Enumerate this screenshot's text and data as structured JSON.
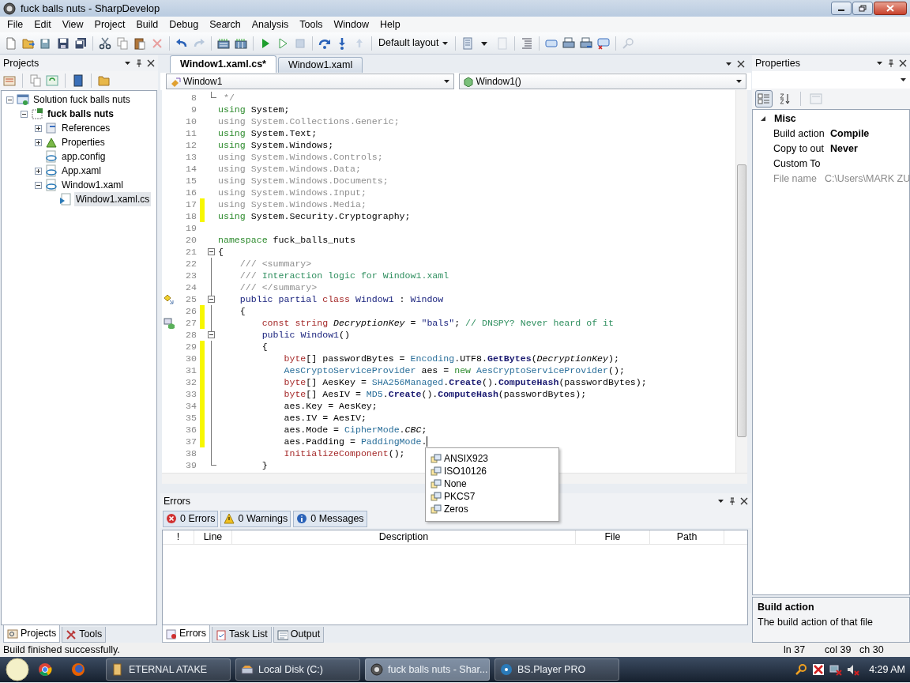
{
  "window": {
    "title": "fuck balls nuts - SharpDevelop"
  },
  "menu": [
    "File",
    "Edit",
    "View",
    "Project",
    "Build",
    "Debug",
    "Search",
    "Analysis",
    "Tools",
    "Window",
    "Help"
  ],
  "toolbar": {
    "layout": "Default layout"
  },
  "projects_panel": {
    "title": "Projects",
    "tree": [
      {
        "label": "Solution fuck balls nuts",
        "kind": "solution",
        "expanded": true,
        "selected": false,
        "children": [
          {
            "label": "fuck balls nuts",
            "kind": "project",
            "startup": true,
            "expanded": true,
            "selected": false,
            "children": [
              {
                "label": "References",
                "kind": "references",
                "expanded": false,
                "selected": false
              },
              {
                "label": "Properties",
                "kind": "properties",
                "expanded": false,
                "selected": false
              },
              {
                "label": "app.config",
                "kind": "xml",
                "selected": false
              },
              {
                "label": "App.xaml",
                "kind": "xml",
                "expanded": false,
                "selected": false
              },
              {
                "label": "Window1.xaml",
                "kind": "xml",
                "expanded": true,
                "selected": false,
                "children": [
                  {
                    "label": "Window1.xaml.cs",
                    "kind": "code",
                    "selected": true
                  }
                ]
              }
            ]
          }
        ]
      }
    ],
    "tabs": [
      {
        "label": "Projects",
        "selected": true
      },
      {
        "label": "Tools",
        "selected": false
      }
    ]
  },
  "editor": {
    "tabs": [
      {
        "label": "Window1.xaml.cs*",
        "selected": true
      },
      {
        "label": "Window1.xaml",
        "selected": false
      }
    ],
    "class_combo": "Window1",
    "member_combo": "Window1()",
    "lines": [
      {
        "n": "8",
        "changed": false,
        "fold_end": true,
        "seg": [
          {
            "text": " */",
            "kind": "dim"
          }
        ]
      },
      {
        "n": "9",
        "changed": false,
        "seg": [
          {
            "text": "using",
            "kind": "kw"
          },
          {
            "text": " System;",
            "kind": "plain"
          }
        ]
      },
      {
        "n": "10",
        "changed": false,
        "seg": [
          {
            "text": "using System.Collections.Generic;",
            "kind": "dim"
          }
        ]
      },
      {
        "n": "11",
        "changed": false,
        "seg": [
          {
            "text": "using",
            "kind": "kw"
          },
          {
            "text": " System.Text;",
            "kind": "plain"
          }
        ]
      },
      {
        "n": "12",
        "changed": false,
        "seg": [
          {
            "text": "using",
            "kind": "kw"
          },
          {
            "text": " System.Windows;",
            "kind": "plain"
          }
        ]
      },
      {
        "n": "13",
        "changed": false,
        "seg": [
          {
            "text": "using System.Windows.Controls;",
            "kind": "dim"
          }
        ]
      },
      {
        "n": "14",
        "changed": false,
        "seg": [
          {
            "text": "using System.Windows.Data;",
            "kind": "dim"
          }
        ]
      },
      {
        "n": "15",
        "changed": false,
        "seg": [
          {
            "text": "using System.Windows.Documents;",
            "kind": "dim"
          }
        ]
      },
      {
        "n": "16",
        "changed": false,
        "seg": [
          {
            "text": "using System.Windows.Input;",
            "kind": "dim"
          }
        ]
      },
      {
        "n": "17",
        "changed": true,
        "seg": [
          {
            "text": "using System.Windows.Media;",
            "kind": "dim"
          }
        ]
      },
      {
        "n": "18",
        "changed": true,
        "seg": [
          {
            "text": "using",
            "kind": "kw"
          },
          {
            "text": " System.Security.Cryptography;",
            "kind": "plain"
          }
        ]
      },
      {
        "n": "19",
        "changed": false
      },
      {
        "n": "20",
        "changed": false,
        "seg": [
          {
            "text": "namespace",
            "kind": "kw"
          },
          {
            "text": " fuck_balls_nuts",
            "kind": "plain"
          }
        ]
      },
      {
        "n": "21",
        "changed": false,
        "fold_open": true,
        "seg": [
          {
            "text": "{",
            "kind": "plain"
          }
        ]
      },
      {
        "n": "22",
        "changed": false,
        "seg": [
          {
            "text": "    /// <summary>",
            "kind": "dim"
          }
        ]
      },
      {
        "n": "23",
        "changed": false,
        "seg": [
          {
            "text": "    /// ",
            "kind": "dim"
          },
          {
            "text": "Interaction logic for Window1.xaml",
            "kind": "comment"
          }
        ]
      },
      {
        "n": "24",
        "changed": false,
        "seg": [
          {
            "text": "    /// </summary>",
            "kind": "dim"
          }
        ]
      },
      {
        "n": "25",
        "changed": false,
        "fold_open": true,
        "kind": "class",
        "seg": [
          {
            "text": "    public partial ",
            "kind": "mod"
          },
          {
            "text": "class ",
            "kind": "reserved"
          },
          {
            "text": "Window1",
            "kind": "decl"
          },
          {
            "text": " : ",
            "kind": "plain"
          },
          {
            "text": "Window",
            "kind": "decl"
          }
        ]
      },
      {
        "n": "26",
        "changed": true,
        "seg": [
          {
            "text": "    {",
            "kind": "plain"
          }
        ]
      },
      {
        "n": "27",
        "changed": true,
        "kind": "member",
        "seg": [
          {
            "text": "        const string ",
            "kind": "reserved"
          },
          {
            "text": "DecryptionKey",
            "kind": "ital"
          },
          {
            "text": " = ",
            "kind": "plain"
          },
          {
            "text": "\"bals\"",
            "kind": "str"
          },
          {
            "text": ";",
            "kind": "plain"
          },
          {
            "text": " // DNSPY? Never heard of it",
            "kind": "comment"
          }
        ]
      },
      {
        "n": "28",
        "changed": false,
        "fold_open": true,
        "seg": [
          {
            "text": "        public ",
            "kind": "mod"
          },
          {
            "text": "Window1",
            "kind": "decl"
          },
          {
            "text": "()",
            "kind": "plain"
          }
        ]
      },
      {
        "n": "29",
        "changed": true,
        "seg": [
          {
            "text": "        {",
            "kind": "plain"
          }
        ]
      },
      {
        "n": "30",
        "changed": true,
        "seg": [
          {
            "text": "            byte",
            "kind": "reserved"
          },
          {
            "text": "[] passwordBytes = ",
            "kind": "plain"
          },
          {
            "text": "Encoding",
            "kind": "type"
          },
          {
            "text": ".UTF8.",
            "kind": "plain"
          },
          {
            "text": "GetBytes",
            "kind": "method"
          },
          {
            "text": "(",
            "kind": "plain"
          },
          {
            "text": "DecryptionKey",
            "kind": "ital"
          },
          {
            "text": ");",
            "kind": "plain"
          }
        ]
      },
      {
        "n": "31",
        "changed": true,
        "seg": [
          {
            "text": "            AesCryptoServiceProvider",
            "kind": "type"
          },
          {
            "text": " aes = ",
            "kind": "plain"
          },
          {
            "text": "new ",
            "kind": "kw"
          },
          {
            "text": "AesCryptoServiceProvider",
            "kind": "type"
          },
          {
            "text": "();",
            "kind": "plain"
          }
        ]
      },
      {
        "n": "32",
        "changed": true,
        "seg": [
          {
            "text": "            byte",
            "kind": "reserved"
          },
          {
            "text": "[] AesKey = ",
            "kind": "plain"
          },
          {
            "text": "SHA256Managed",
            "kind": "type"
          },
          {
            "text": ".",
            "kind": "plain"
          },
          {
            "text": "Create",
            "kind": "method"
          },
          {
            "text": "().",
            "kind": "plain"
          },
          {
            "text": "ComputeHash",
            "kind": "method"
          },
          {
            "text": "(passwordBytes);",
            "kind": "plain"
          }
        ]
      },
      {
        "n": "33",
        "changed": true,
        "seg": [
          {
            "text": "            byte",
            "kind": "reserved"
          },
          {
            "text": "[] AesIV = ",
            "kind": "plain"
          },
          {
            "text": "MD5",
            "kind": "type"
          },
          {
            "text": ".",
            "kind": "plain"
          },
          {
            "text": "Create",
            "kind": "method"
          },
          {
            "text": "().",
            "kind": "plain"
          },
          {
            "text": "ComputeHash",
            "kind": "method"
          },
          {
            "text": "(passwordBytes);",
            "kind": "plain"
          }
        ]
      },
      {
        "n": "34",
        "changed": true,
        "seg": [
          {
            "text": "            aes.Key = AesKey;",
            "kind": "plain"
          }
        ]
      },
      {
        "n": "35",
        "changed": true,
        "seg": [
          {
            "text": "            aes.IV = AesIV;",
            "kind": "plain"
          }
        ]
      },
      {
        "n": "36",
        "changed": true,
        "seg": [
          {
            "text": "            aes.Mode = ",
            "kind": "plain"
          },
          {
            "text": "CipherMode",
            "kind": "type"
          },
          {
            "text": ".",
            "kind": "plain"
          },
          {
            "text": "CBC",
            "kind": "ital"
          },
          {
            "text": ";",
            "kind": "plain"
          }
        ]
      },
      {
        "n": "37",
        "changed": true,
        "caret": true,
        "seg": [
          {
            "text": "            aes.Padding = ",
            "kind": "plain"
          },
          {
            "text": "PaddingMode",
            "kind": "type"
          },
          {
            "text": ".",
            "kind": "plain"
          }
        ]
      },
      {
        "n": "38",
        "changed": false,
        "seg": [
          {
            "text": "            InitializeComponent",
            "kind": "reserved"
          },
          {
            "text": "();",
            "kind": "plain"
          }
        ]
      },
      {
        "n": "39",
        "changed": false,
        "fold_end": true,
        "seg": [
          {
            "text": "        }",
            "kind": "plain"
          }
        ]
      }
    ],
    "completion": [
      "ANSIX923",
      "ISO10126",
      "None",
      "PKCS7",
      "Zeros"
    ]
  },
  "errors_panel": {
    "title": "Errors",
    "filters": [
      {
        "label": "0 Errors",
        "kind": "error",
        "on": true
      },
      {
        "label": "0 Warnings",
        "kind": "warning",
        "on": true
      },
      {
        "label": "0 Messages",
        "kind": "info",
        "on": true
      }
    ],
    "columns": [
      "!",
      "Line",
      "Description",
      "File",
      "Path"
    ],
    "tabs": [
      {
        "label": "Errors",
        "kind": "errors",
        "selected": true
      },
      {
        "label": "Task List",
        "kind": "tasks",
        "selected": false
      },
      {
        "label": "Output",
        "kind": "output",
        "selected": false
      }
    ]
  },
  "properties_panel": {
    "title": "Properties",
    "view_buttons": [
      {
        "kind": "categorized",
        "selected": true
      },
      {
        "kind": "alphabetical",
        "selected": false
      },
      {
        "kind": "pages",
        "selected": false
      }
    ],
    "category": {
      "title": "Misc",
      "expanded": true,
      "rows": [
        {
          "name": "Build action",
          "value": "Compile",
          "disabled": false
        },
        {
          "name": "Copy to out",
          "value": "Never",
          "disabled": false
        },
        {
          "name": "Custom To",
          "disabled": false
        },
        {
          "name": "File name",
          "value": "C:\\Users\\MARK ZU",
          "disabled": true
        }
      ]
    },
    "description": {
      "title": "Build action",
      "text": "The build action of that file"
    }
  },
  "status_bar": {
    "message": "Build finished successfully.",
    "line": "ln 37",
    "col": "col 39",
    "ch": "ch 30"
  },
  "taskbar": {
    "buttons": [
      {
        "label": "ETERNAL ATAKE",
        "kind": "book",
        "selected": false
      },
      {
        "label": "Local Disk (C:)",
        "kind": "drive",
        "selected": false
      },
      {
        "label": "fuck balls nuts - Shar...",
        "kind": "app",
        "selected": true
      },
      {
        "label": "BS.Player PRO",
        "kind": "player",
        "selected": false
      }
    ],
    "clock": "4:29 AM"
  }
}
